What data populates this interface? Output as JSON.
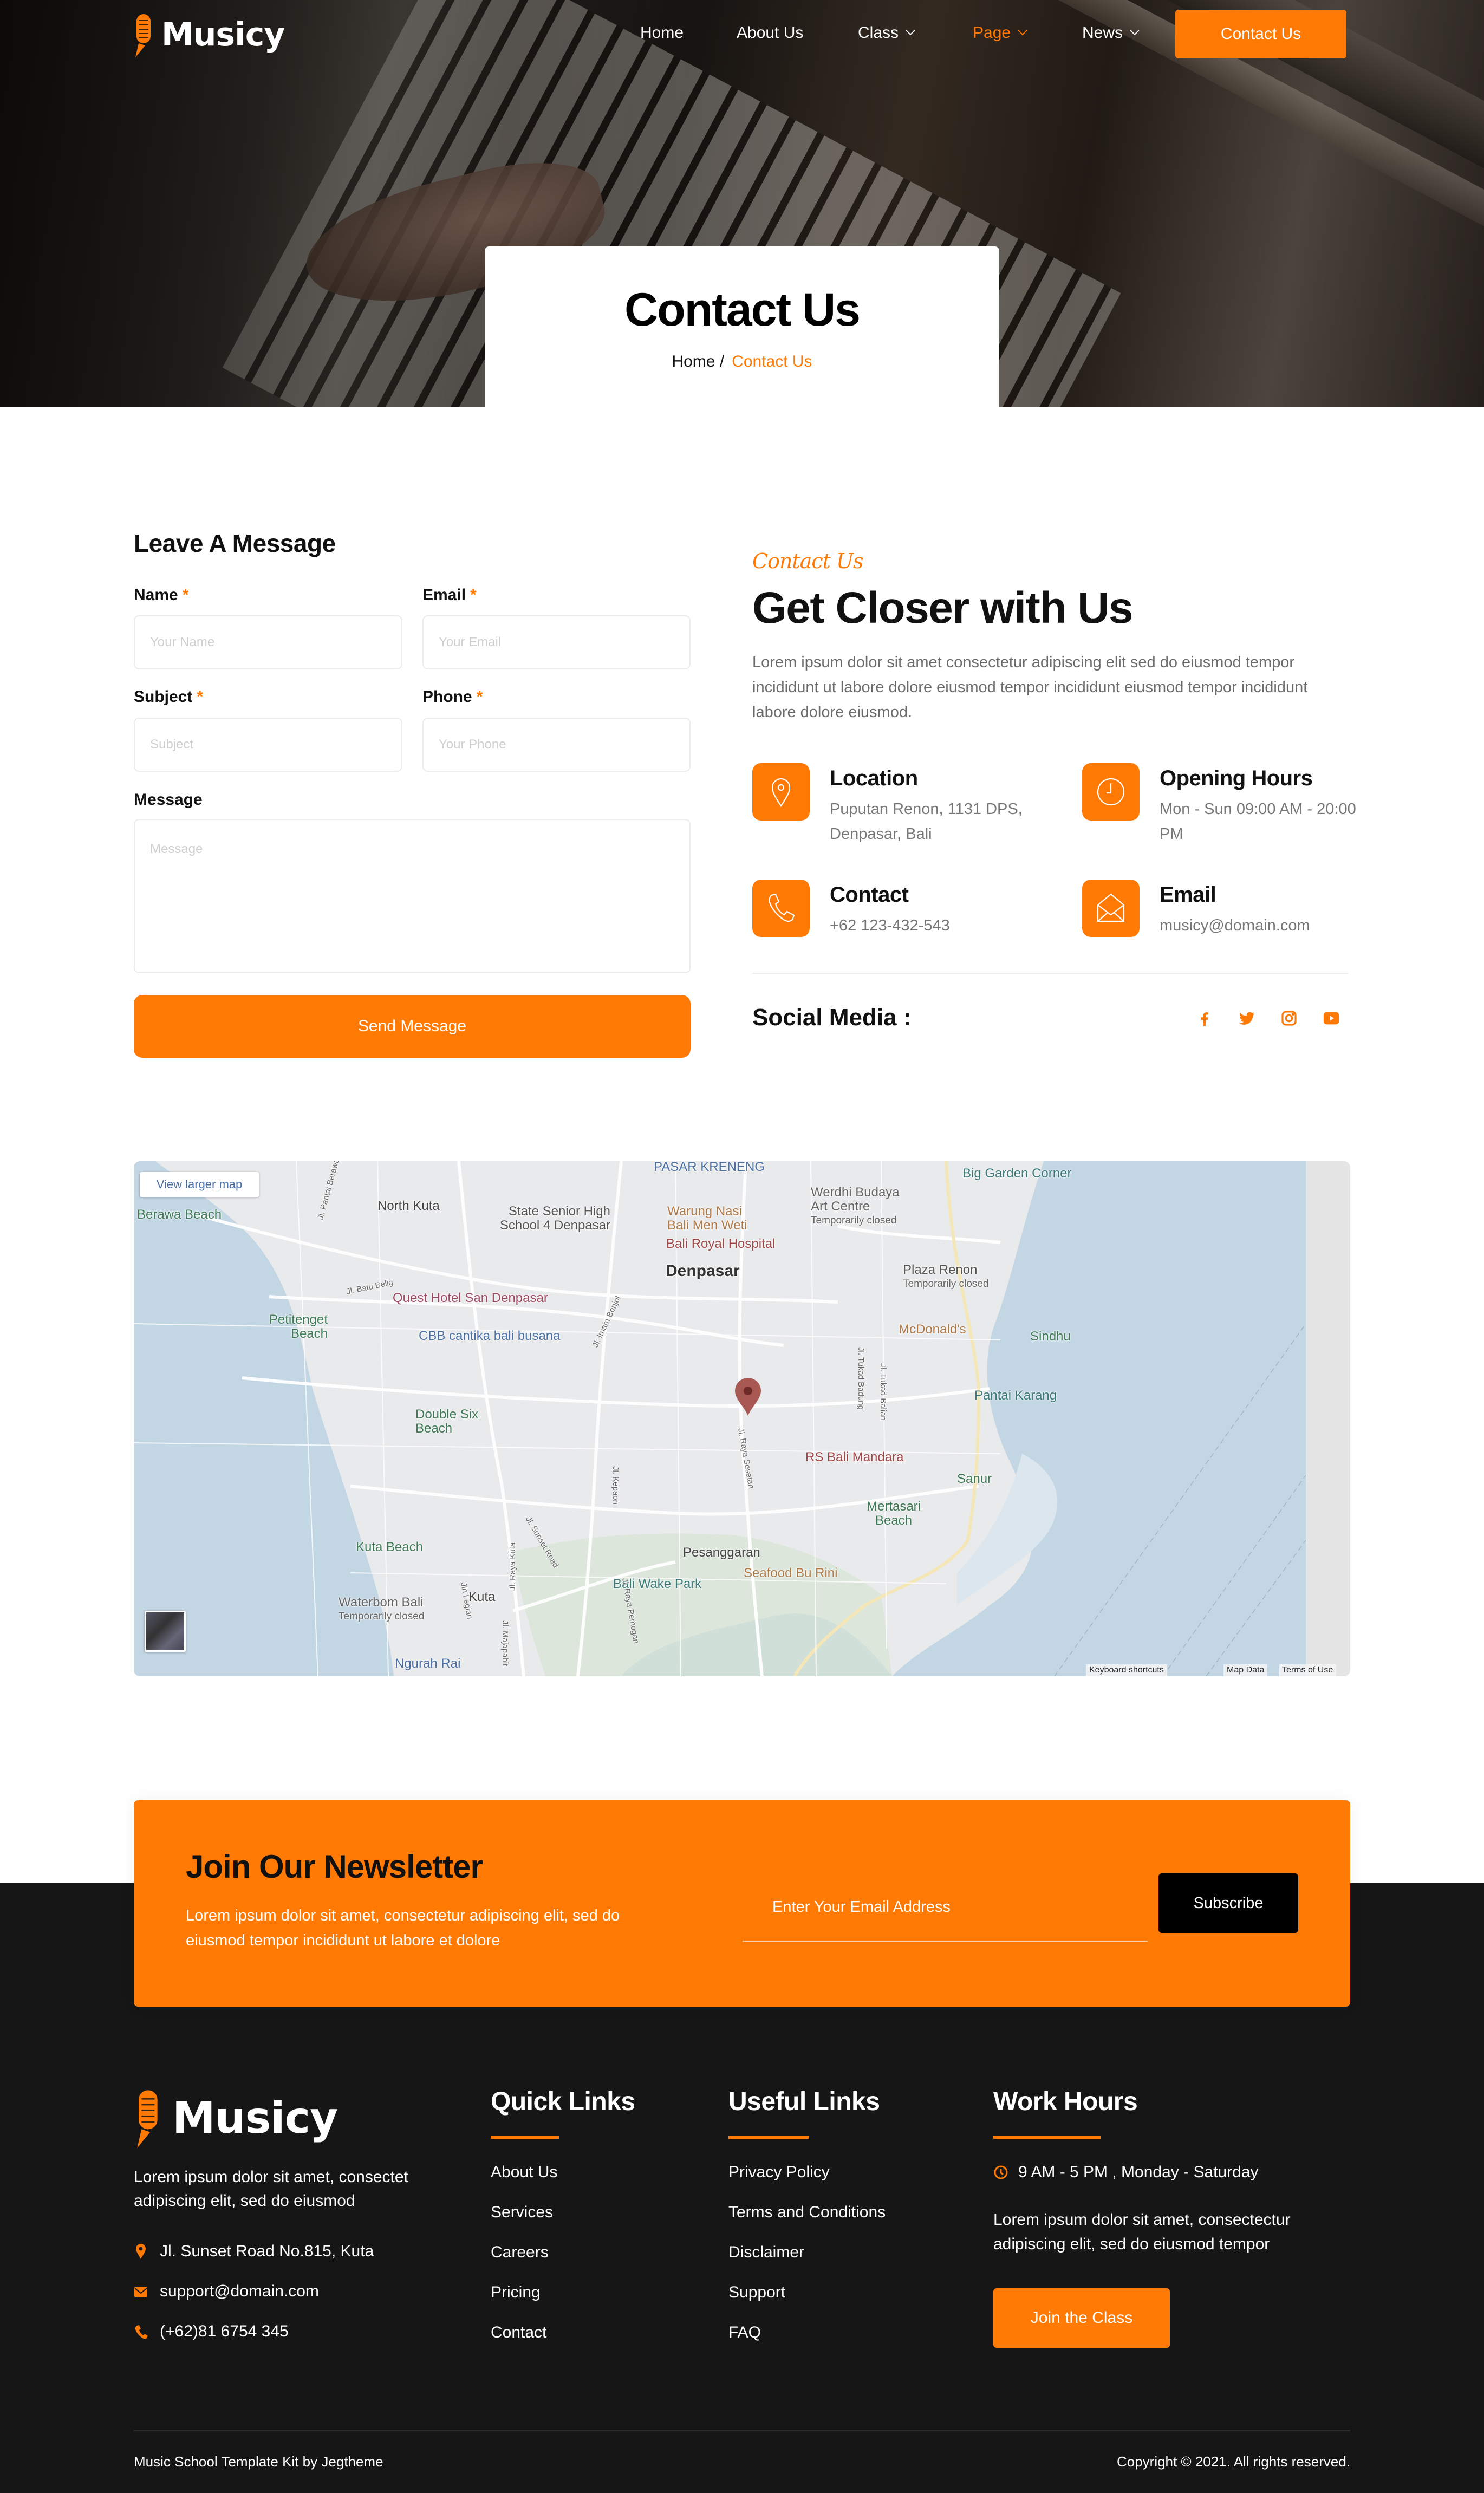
{
  "brand": {
    "name": "Musicy",
    "accent_color": "#ff7a05",
    "dark_color": "#161616"
  },
  "nav": {
    "items": [
      {
        "label": "Home",
        "dropdown": false,
        "active": false
      },
      {
        "label": "About Us",
        "dropdown": false,
        "active": false
      },
      {
        "label": "Class",
        "dropdown": true,
        "active": false
      },
      {
        "label": "Page",
        "dropdown": true,
        "active": true
      },
      {
        "label": "News",
        "dropdown": true,
        "active": false
      }
    ],
    "cta_label": "Contact Us"
  },
  "hero": {
    "title": "Contact Us",
    "breadcrumb": {
      "home": "Home /",
      "current": "Contact Us"
    }
  },
  "form": {
    "title": "Leave A Message",
    "required_mark": "*",
    "fields": {
      "name": {
        "label": "Name",
        "placeholder": "Your Name",
        "value": ""
      },
      "email": {
        "label": "Email",
        "placeholder": "Your Email",
        "value": ""
      },
      "subject": {
        "label": "Subject",
        "placeholder": "Subject",
        "value": ""
      },
      "phone": {
        "label": "Phone",
        "placeholder": "Your Phone",
        "value": ""
      },
      "message": {
        "label": "Message",
        "placeholder": "Message",
        "value": ""
      }
    },
    "submit_label": "Send Message"
  },
  "info": {
    "script_label": "Contact Us",
    "title": "Get Closer with Us",
    "paragraph": "Lorem ipsum dolor sit amet consectetur adipiscing elit sed do eiusmod tempor incididunt ut labore dolore eiusmod tempor incididunt eiusmod tempor incididunt labore dolore eiusmod.",
    "items": [
      {
        "icon": "map-pin-icon",
        "title": "Location",
        "value": "Puputan Renon, 1131 DPS, Denpasar, Bali"
      },
      {
        "icon": "clock-icon",
        "title": "Opening Hours",
        "value": "Mon - Sun 09:00 AM - 20:00 PM"
      },
      {
        "icon": "phone-icon",
        "title": "Contact",
        "value": "+62 123-432-543"
      },
      {
        "icon": "envelope-icon",
        "title": "Email",
        "value": "musicy@domain.com"
      }
    ],
    "social_label": "Social Media :",
    "social": [
      "facebook-icon",
      "twitter-icon",
      "instagram-icon",
      "youtube-icon"
    ]
  },
  "map": {
    "view_larger": "View larger map",
    "labels": {
      "pasar_kreneng": "PASAR KRENENG",
      "big_garden": "Big Garden Corner",
      "werdhi": "Werdhi Budaya Art Centre",
      "werdhi_status": "Temporarily closed",
      "north_kuta": "North Kuta",
      "state_school": "State Senior High School 4 Denpasar",
      "warung": "Warung Nasi Bali Men Weti",
      "bali_royal": "Bali Royal Hospital",
      "berawa": "Berawa Beach",
      "denpasar": "Denpasar",
      "plaza_renon": "Plaza Renon",
      "plaza_status": "Temporarily closed",
      "quest": "Quest Hotel San Denpasar",
      "petitenget": "Petitenget Beach",
      "mcdonalds": "McDonald's",
      "sindhu": "Sindhu",
      "cbb": "CBB cantika bali busana",
      "pantai_karang": "Pantai Karang",
      "double_six": "Double Six Beach",
      "rs_mandara": "RS Bali Mandara",
      "sanur": "Sanur",
      "mertasari": "Mertasari Beach",
      "kuta_beach": "Kuta Beach",
      "pesanggaran": "Pesanggaran",
      "seafood": "Seafood Bu Rini",
      "wake_park": "Bali Wake Park",
      "kuta": "Kuta",
      "waterbom": "Waterbom Bali",
      "waterbom_status": "Temporarily closed",
      "ngurah_rai": "Ngurah Rai",
      "jl_batu_belig": "Jl. Batu Belig",
      "jl_imam_bonjol": "Jl. Imam Bonjol",
      "jl_raya_sesetan": "Jl. Raya Sesetan",
      "jl_tukad_badung": "Jl. Tukad Badung",
      "jl_tukad_balian": "Jl. Tukad Balian",
      "jl_kepaon": "Jl. Kepaon",
      "jl_sunset": "Jl. Sunset Road",
      "jl_legian": "Jln Legian",
      "jl_raya_kuta": "Jl. Raya Kuta",
      "jl_majapahit": "Jl. Majapahit",
      "jl_pemogan": "Jl. Raya Pemogan",
      "jl_pantai_berawa": "Jl. Pantai Berawa"
    },
    "footer": {
      "shortcuts": "Keyboard shortcuts",
      "map_data": "Map Data",
      "terms": "Terms of Use"
    }
  },
  "newsletter": {
    "title": "Join Our Newsletter",
    "text": "Lorem ipsum dolor sit amet, consectetur adipiscing elit, sed do eiusmod tempor incididunt ut labore et dolore",
    "email_placeholder": "Enter Your Email Address",
    "email_value": "",
    "subscribe_label": "Subscribe"
  },
  "footer": {
    "about": "Lorem ipsum dolor sit amet, consectet adipiscing elit, sed do eiusmod",
    "address": "Jl. Sunset Road No.815, Kuta",
    "email": "support@domain.com",
    "phone": "(+62)81 6754 345",
    "quick_links": {
      "title": "Quick Links",
      "items": [
        "About Us",
        "Services",
        "Careers",
        "Pricing",
        "Contact"
      ]
    },
    "useful_links": {
      "title": "Useful Links",
      "items": [
        "Privacy Policy",
        "Terms and Conditions",
        "Disclaimer",
        "Support",
        "FAQ"
      ]
    },
    "work_hours": {
      "title": "Work Hours",
      "time": "9 AM - 5 PM , Monday - Saturday",
      "text": "Lorem ipsum dolor sit amet, consectectur adipiscing elit, sed do eiusmod tempor",
      "cta_label": "Join the Class"
    },
    "credit": "Music School Template Kit by Jegtheme",
    "copyright": "Copyright © 2021. All rights reserved."
  }
}
